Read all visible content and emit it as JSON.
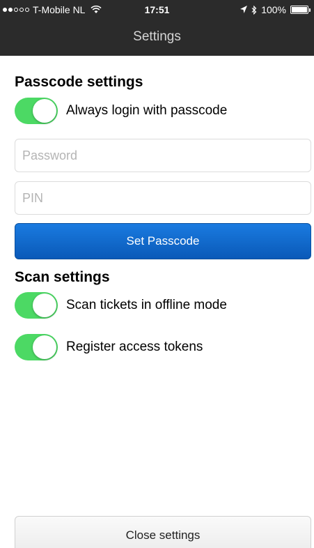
{
  "status_bar": {
    "carrier": "T-Mobile NL",
    "time": "17:51",
    "battery": "100%",
    "battery_level": 1.0
  },
  "header": {
    "title": "Settings"
  },
  "passcode": {
    "section_title": "Passcode settings",
    "always_login_label": "Always login with passcode",
    "always_login_on": true,
    "password_placeholder": "Password",
    "pin_placeholder": "PIN",
    "set_button": "Set Passcode"
  },
  "scan": {
    "section_title": "Scan settings",
    "offline_label": "Scan tickets in offline mode",
    "offline_on": true,
    "register_label": "Register access tokens",
    "register_on": true
  },
  "footer": {
    "close_button": "Close settings"
  },
  "colors": {
    "toggle_on": "#4cd964",
    "primary_button": "#1a6fd0",
    "header_bg": "#2b2b2b"
  }
}
